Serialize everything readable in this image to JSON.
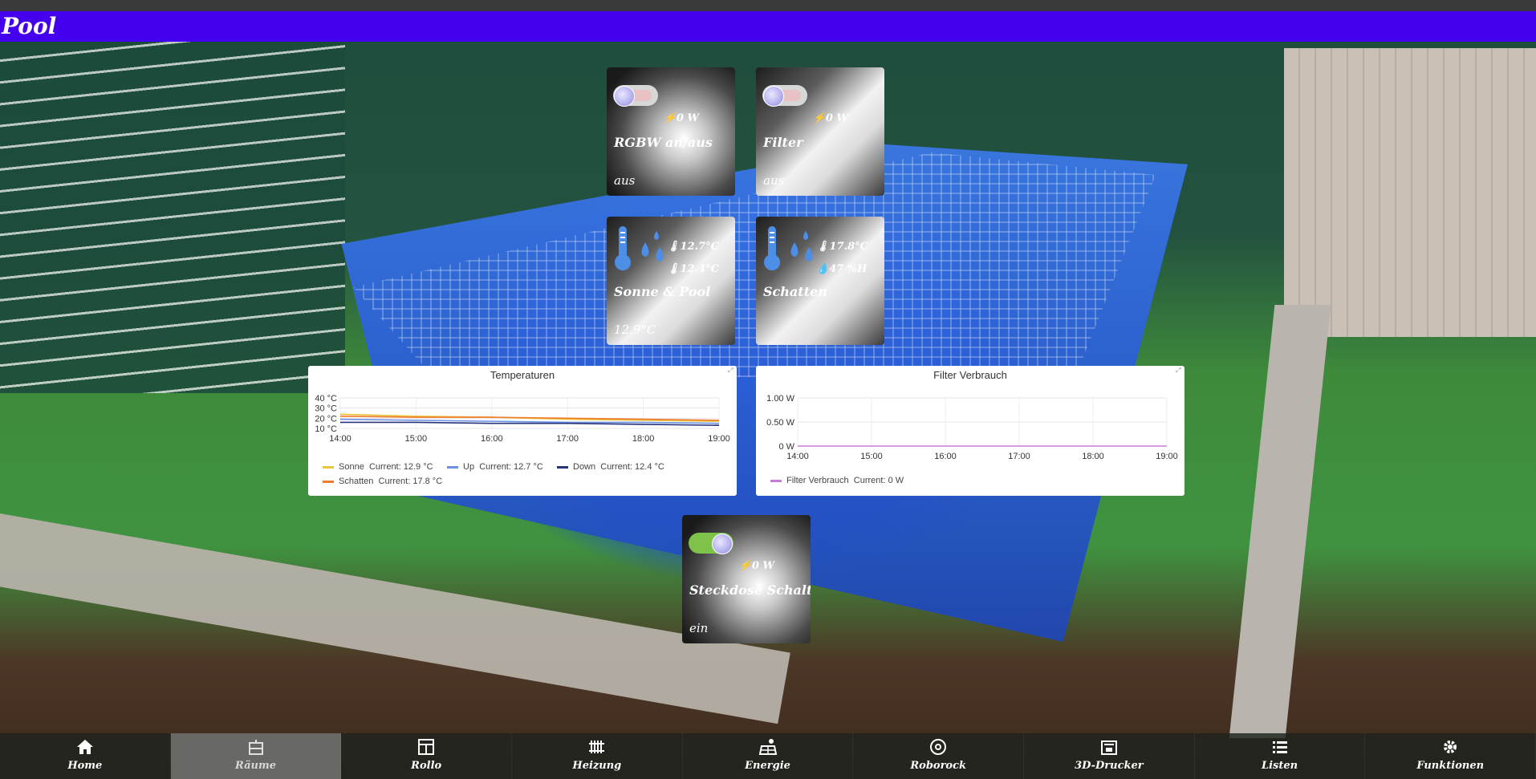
{
  "header": {
    "title": "Pool"
  },
  "tiles": {
    "rgbw": {
      "name": "RGBW an/aus",
      "state": "aus",
      "power": "0 W"
    },
    "filter": {
      "name": "Filter",
      "state": "aus",
      "power": "0 W"
    },
    "sonne_pool": {
      "name": "Sonne & Pool",
      "value": "12.9°C",
      "temp1": "12.7°C",
      "temp2": "12.4°C"
    },
    "schatten": {
      "name": "Schatten",
      "temp": "17.8°C",
      "humidity": "47 %H"
    },
    "steckdose": {
      "name": "Steckdose Schalter",
      "state": "ein",
      "power": "0 W"
    }
  },
  "chart_data": [
    {
      "type": "line",
      "title": "Temperaturen",
      "x": [
        "14:00",
        "15:00",
        "16:00",
        "17:00",
        "18:00",
        "19:00"
      ],
      "y_ticks": [
        "40 °C",
        "30 °C",
        "20 °C",
        "10 °C"
      ],
      "ylim": [
        10,
        40
      ],
      "series": [
        {
          "name": "Sonne",
          "current": "Current: 12.9 °C",
          "color": "#e8c53a",
          "values": [
            24,
            22,
            21,
            19,
            18,
            17
          ]
        },
        {
          "name": "Up",
          "current": "Current: 12.7 °C",
          "color": "#6b8fe3",
          "values": [
            19,
            18,
            17,
            16,
            16,
            15
          ]
        },
        {
          "name": "Down",
          "current": "Current: 12.4 °C",
          "color": "#27337a",
          "values": [
            16,
            16,
            15,
            15,
            14,
            13
          ]
        },
        {
          "name": "Schatten",
          "current": "Current: 17.8 °C",
          "color": "#f07a2e",
          "values": [
            22,
            21,
            21,
            20,
            19,
            18
          ]
        }
      ]
    },
    {
      "type": "line",
      "title": "Filter Verbrauch",
      "x": [
        "14:00",
        "15:00",
        "16:00",
        "17:00",
        "18:00",
        "19:00"
      ],
      "y_ticks": [
        "1.00 W",
        "0.50 W",
        "0 W"
      ],
      "ylim": [
        0,
        1
      ],
      "series": [
        {
          "name": "Filter Verbrauch",
          "current": "Current: 0 W",
          "color": "#c87bd8",
          "values": [
            0,
            0,
            0,
            0,
            0,
            0
          ]
        }
      ]
    }
  ],
  "navbar": {
    "items": [
      {
        "label": "Home",
        "icon": "home-icon"
      },
      {
        "label": "Räume",
        "icon": "rooms-icon",
        "active": true
      },
      {
        "label": "Rollo",
        "icon": "window-icon"
      },
      {
        "label": "Heizung",
        "icon": "radiator-icon"
      },
      {
        "label": "Energie",
        "icon": "solar-icon"
      },
      {
        "label": "Roborock",
        "icon": "robot-vacuum-icon"
      },
      {
        "label": "3D-Drucker",
        "icon": "printer-icon"
      },
      {
        "label": "Listen",
        "icon": "list-icon"
      },
      {
        "label": "Funktionen",
        "icon": "gear-icon"
      }
    ]
  }
}
